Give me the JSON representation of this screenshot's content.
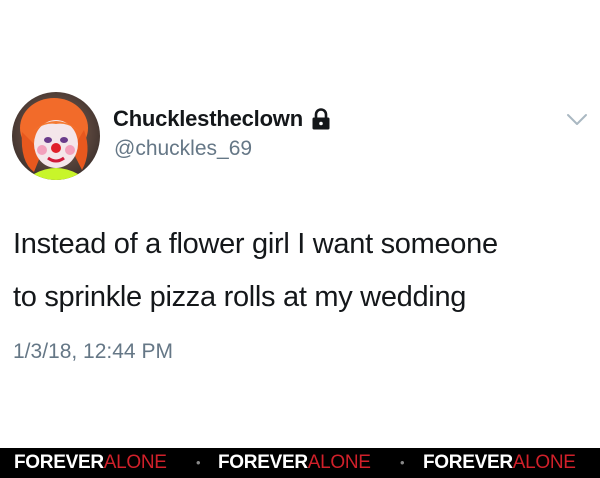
{
  "tweet": {
    "display_name": "Chucklestheclown",
    "handle": "@chuckles_69",
    "text_lines": [
      "Instead of a flower girl I want someone",
      "to sprinkle pizza rolls at my wedding"
    ],
    "timestamp": "1/3/18, 12:44 PM",
    "protected_account": true
  },
  "icons": {
    "lock": "lock-icon",
    "menu": "chevron-down-icon",
    "avatar": "clown-avatar"
  },
  "watermark": {
    "items": [
      {
        "forever": "FOREVER",
        "alone": "ALONE"
      },
      {
        "forever": "FOREVER",
        "alone": "ALONE"
      },
      {
        "forever": "FOREVER",
        "alone": "ALONE"
      }
    ],
    "separator": "•"
  },
  "colors": {
    "name": "#14171a",
    "secondary": "#657786",
    "watermark_alone": "#d0202a",
    "watermark_bg": "#000000"
  }
}
